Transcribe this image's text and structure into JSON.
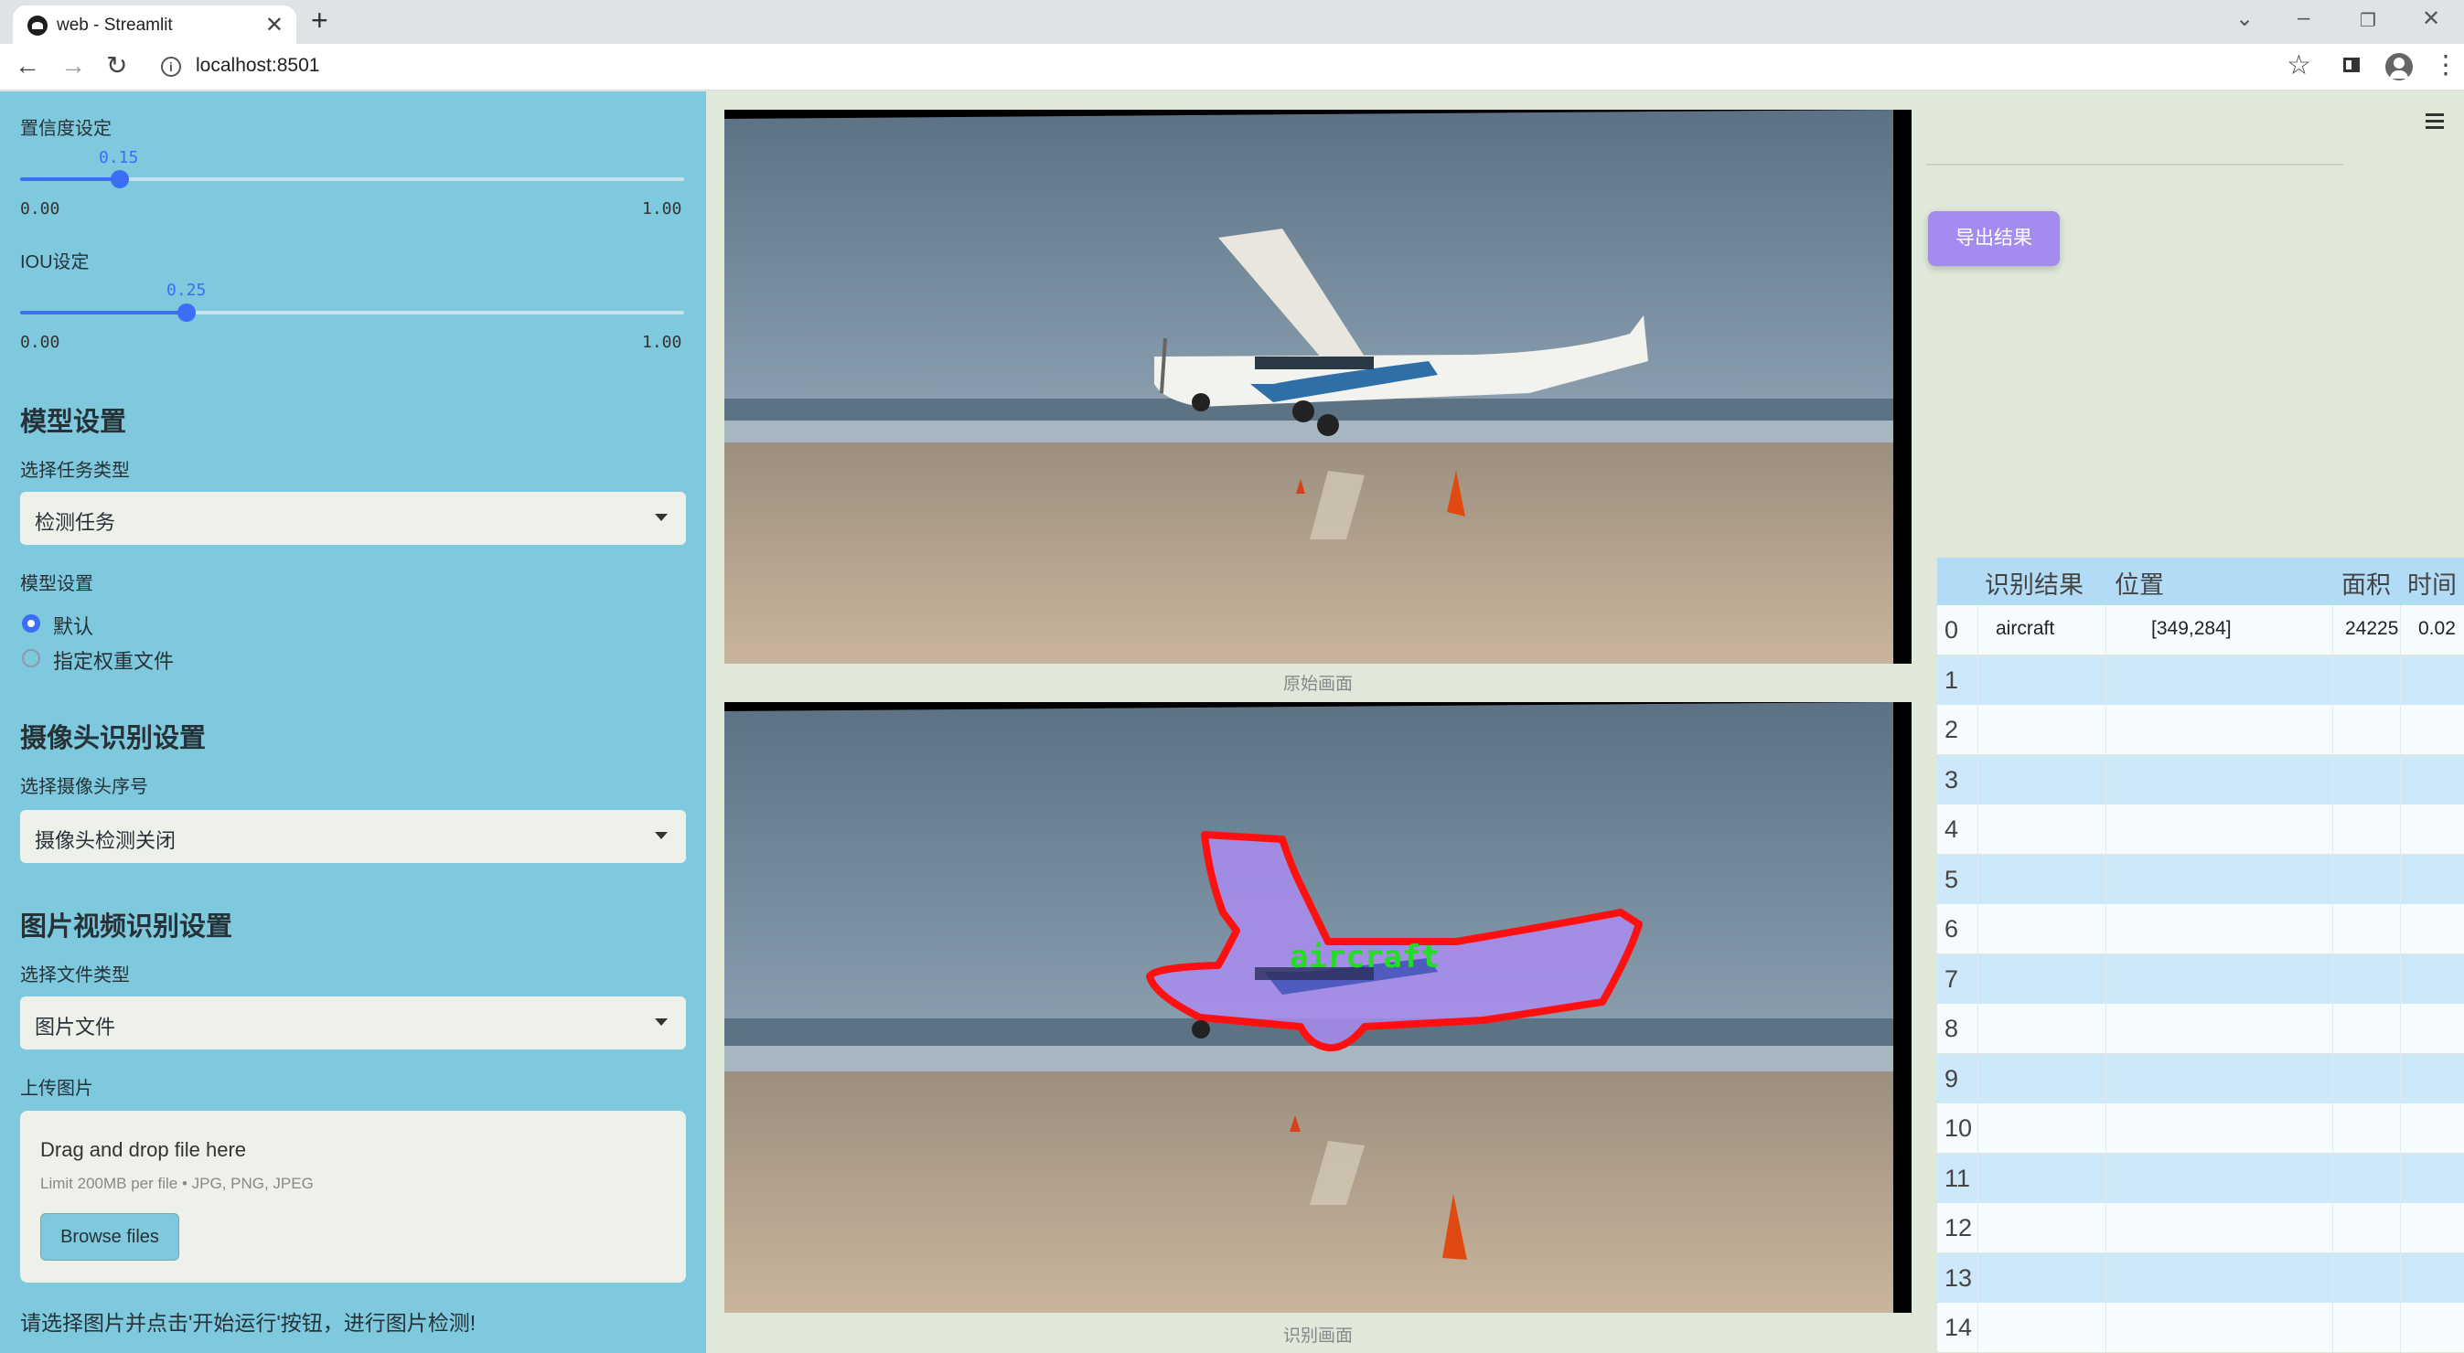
{
  "browser": {
    "tab_title": "web - Streamlit",
    "url": "localhost:8501"
  },
  "sidebar": {
    "confidence": {
      "label": "置信度设定",
      "value": "0.15",
      "value_num": 0.15,
      "min": "0.00",
      "max": "1.00"
    },
    "iou": {
      "label": "IOU设定",
      "value": "0.25",
      "value_num": 0.25,
      "min": "0.00",
      "max": "1.00"
    },
    "model_section": {
      "title": "模型设置",
      "task_label": "选择任务类型",
      "task_value": "检测任务",
      "model_label": "模型设置",
      "options": [
        "默认",
        "指定权重文件"
      ],
      "selected": 0
    },
    "camera_section": {
      "title": "摄像头识别设置",
      "camera_label": "选择摄像头序号",
      "camera_value": "摄像头检测关闭"
    },
    "media_section": {
      "title": "图片视频识别设置",
      "file_type_label": "选择文件类型",
      "file_type_value": "图片文件",
      "upload_label": "上传图片"
    },
    "uploader": {
      "title": "Drag and drop file here",
      "limit": "Limit 200MB per file • JPG, PNG, JPEG",
      "button": "Browse files"
    },
    "hint": "请选择图片并点击'开始运行'按钮，进行图片检测!"
  },
  "main": {
    "original_caption": "原始画面",
    "result_caption": "识别画面",
    "detection_label": "aircraft",
    "export_button": "导出结果",
    "table": {
      "headers": [
        "识别结果",
        "位置",
        "面积",
        "时间"
      ],
      "rows": [
        {
          "index": "0",
          "result": "aircraft",
          "position": "[349,284]",
          "area": "24225",
          "time": "0.02"
        },
        {
          "index": "1"
        },
        {
          "index": "2"
        },
        {
          "index": "3"
        },
        {
          "index": "4"
        },
        {
          "index": "5"
        },
        {
          "index": "6"
        },
        {
          "index": "7"
        },
        {
          "index": "8"
        },
        {
          "index": "9"
        },
        {
          "index": "10"
        },
        {
          "index": "11"
        },
        {
          "index": "12"
        },
        {
          "index": "13"
        },
        {
          "index": "14"
        }
      ]
    }
  },
  "colors": {
    "sidebar_bg": "#7ec9dd",
    "accent": "#3b6ef5",
    "export_btn": "#a48bf0",
    "mask_outline": "#ff1010",
    "mask_fill": "#a98cf0",
    "label_green": "#22dd22"
  }
}
